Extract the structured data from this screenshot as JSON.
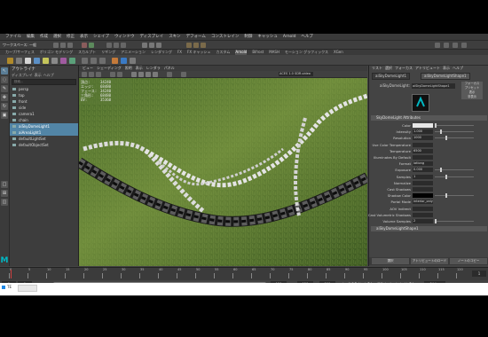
{
  "app": {
    "menu": [
      "ファイル",
      "編集",
      "作成",
      "選択",
      "修正",
      "表示",
      "シェイプ",
      "ウィンドウ",
      "ディスプレイ",
      "スキン",
      "デフォーム",
      "コンストレイン",
      "制御",
      "キャッシュ",
      "Arnold",
      "ヘルプ"
    ],
    "workspace_label": "ワークスペース: 一般",
    "shelf_tabs": [
      "カーブ/サーフェス",
      "ポリゴン モデリング",
      "スカルプト",
      "リギング",
      "アニメーション",
      "レンダリング",
      "FX",
      "FX キャッシュ",
      "カスタム",
      "Arnold",
      "Bifrost",
      "MASH",
      "モーション グラフィックス",
      "XGen"
    ]
  },
  "outliner": {
    "title": "アウトライナ",
    "menu": [
      "ディスプレイ",
      "表示",
      "ヘルプ"
    ],
    "search_placeholder": "検索...",
    "items": [
      {
        "label": "persp",
        "selected": false
      },
      {
        "label": "top",
        "selected": false
      },
      {
        "label": "front",
        "selected": false
      },
      {
        "label": "side",
        "selected": false
      },
      {
        "label": "camera1",
        "selected": false
      },
      {
        "label": "chain",
        "selected": false
      },
      {
        "label": "aiSkyDomeLight1",
        "selected": true
      },
      {
        "label": "aiAreaLight1",
        "selected": true
      },
      {
        "label": "defaultLightSet",
        "selected": false
      },
      {
        "label": "defaultObjectSet",
        "selected": false
      }
    ]
  },
  "viewport": {
    "menu": [
      "ビュー",
      "シェーディング",
      "照明",
      "表示",
      "レンダラ",
      "パネル"
    ],
    "camera_field": "ACES 1.0 SDR-video",
    "hud": [
      "頂点:",
      "エッジ:",
      "フェース:",
      "三角形:",
      "UV:"
    ],
    "hud_values": [
      "34240",
      "68480",
      "34240",
      "68480",
      "35360"
    ]
  },
  "attribute_editor": {
    "tabs": [
      "リスト",
      "選択",
      "フォーカス",
      "アトリビュート",
      "表示",
      "ヘルプ"
    ],
    "node_tabs": [
      "aiSkyDomeLight1",
      "aiSkyDomeLightShape1"
    ],
    "shape_label": "aiSkyDomeLight:",
    "shape_value": "aiSkyDomeLightShape1",
    "buttons": [
      "フォーカス",
      "プリセット",
      "表示",
      "非表示"
    ],
    "section_main": "SkyDomeLight Attributes",
    "attrs": [
      {
        "label": "Color",
        "value": ""
      },
      {
        "label": "Intensity",
        "value": "1.000"
      },
      {
        "label": "Resolution",
        "value": "1000"
      },
      {
        "label": "Use Color Temperature",
        "value": ""
      },
      {
        "label": "Temperature",
        "value": "6500"
      },
      {
        "label": "Illuminates By Default",
        "value": ""
      },
      {
        "label": "Format",
        "value": "latlong"
      },
      {
        "label": "Exposure",
        "value": "0.000"
      },
      {
        "label": "Samples",
        "value": "1"
      },
      {
        "label": "Normalize",
        "value": ""
      },
      {
        "label": "Cast Shadows",
        "value": ""
      },
      {
        "label": "Shadow Color",
        "value": ""
      },
      {
        "label": "Portal Mode",
        "value": "interior_only"
      },
      {
        "label": "AOV Indirect",
        "value": ""
      },
      {
        "label": "Cast Volumetric Shadows",
        "value": ""
      },
      {
        "label": "Volume Samples",
        "value": "2"
      }
    ],
    "section_bottom": "aiSkyDomeLightShape1",
    "bottom_buttons": [
      "選択",
      "アトリビュートのロード",
      "ノートのコピー"
    ]
  },
  "timeline": {
    "ticks": [
      "0",
      "5",
      "10",
      "15",
      "20",
      "25",
      "30",
      "35",
      "40",
      "45",
      "50",
      "55",
      "60",
      "65",
      "70",
      "75",
      "80",
      "85",
      "90",
      "95",
      "100",
      "105",
      "110",
      "115",
      "120"
    ],
    "current_frame": "1"
  },
  "range": {
    "start": "1",
    "inner_start": "1",
    "inner_end": "120",
    "end": "120",
    "anim_end": "200",
    "char_set": "キャラクタ セットなし",
    "anim_layer": "アニメーション レイヤなし",
    "fps": "24 fps"
  },
  "command_line": {
    "lang": "MEL",
    "task_label": "TE"
  },
  "colors": {
    "selection": "#5285a6",
    "accent_logo": "#00b7c3",
    "ui_bg": "#444444"
  }
}
